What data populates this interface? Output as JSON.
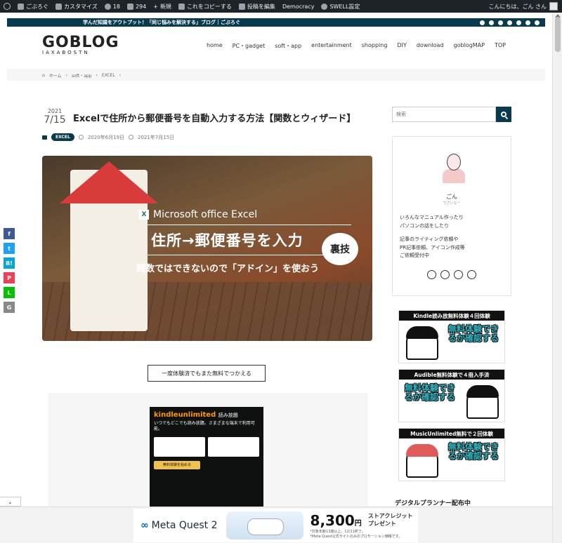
{
  "adminbar": {
    "site": "ごぶろぐ",
    "customize": "カスタマイズ",
    "updates": "18",
    "comments": "294",
    "new": "新規",
    "copy": "これをコピーする",
    "edit": "投稿を編集",
    "democracy": "Democracy",
    "swell": "SWELL設定",
    "greeting": "こんにちは、ごん さん"
  },
  "topbar": {
    "tagline": "学んだ知識をアウトプット！「同じ悩みを解決する」ブログ｜ごぶろぐ"
  },
  "header": {
    "logo": "GOBLOG",
    "logo_sub": "IAXABOSTN",
    "nav": [
      "home",
      "PC・gadget",
      "soft・app",
      "entertainment",
      "shopping",
      "DIY",
      "download",
      "goblogMAP",
      "TOP"
    ]
  },
  "breadcrumb": {
    "home": "ホーム",
    "level1": "soft・app",
    "level2": "EXCEL"
  },
  "post": {
    "year": "2021",
    "monthday": "7/15",
    "title": "Excelで住所から郵便番号を自動入力する方法【関数とウィザード】",
    "category": "EXCEL",
    "published": "2020年6月19日",
    "updated": "2021年7月15日"
  },
  "eyecatch": {
    "brand": "Microsoft office Excel",
    "headline": "住所→郵便番号を入力",
    "badge": "裏技",
    "subline": "関数ではできないので「アドイン」を使おう"
  },
  "promo": {
    "caption": "一度体験済でもまた無料でつかえる",
    "kindle_logo": "kindleunlimited",
    "kindle_suffix": "読み放題",
    "kindle_desc": "いつでもどこでも読み放題。さまざまな端末で利用可能。",
    "kindle_button": "無料体験を始める"
  },
  "sidebar": {
    "search_placeholder": "検索",
    "profile_name": "ごん",
    "profile_sub": "でざいなー",
    "bio1": "いろんなマニュアル作ったり",
    "bio2": "パソコンの話をしたり",
    "bio3": "記事のライティング依頼や",
    "bio4": "PR記事依頼、アイコン作成等",
    "bio5": "ご依頼受付中",
    "banners": [
      {
        "title": "Kindle読み放無料体験４回体験",
        "text": "無料体験できるか確認する"
      },
      {
        "title": "Audible無料体験で４冊入手済",
        "text": "無料体験できるか確認する"
      },
      {
        "title": "MusicUnlimited無料で２回体験",
        "text": "無料体験できるか確認する"
      }
    ],
    "heading": "デジタルプランナー配布中"
  },
  "share": [
    "f",
    "t",
    "B!",
    "P",
    "L",
    "G"
  ],
  "ad": {
    "brand": "Meta Quest 2",
    "amount": "8,300",
    "unit": "円",
    "credit1": "ストアクレジット",
    "credit2": "プレゼント",
    "fine1": "*対象年齢13歳以上。12/11終了。",
    "fine2": "*Meta Quest公式サイトのみのプロモーション価格です。"
  },
  "colors": {
    "navy": "#083a4d",
    "admin": "#1d2327",
    "teal": "#2bb6c4"
  }
}
